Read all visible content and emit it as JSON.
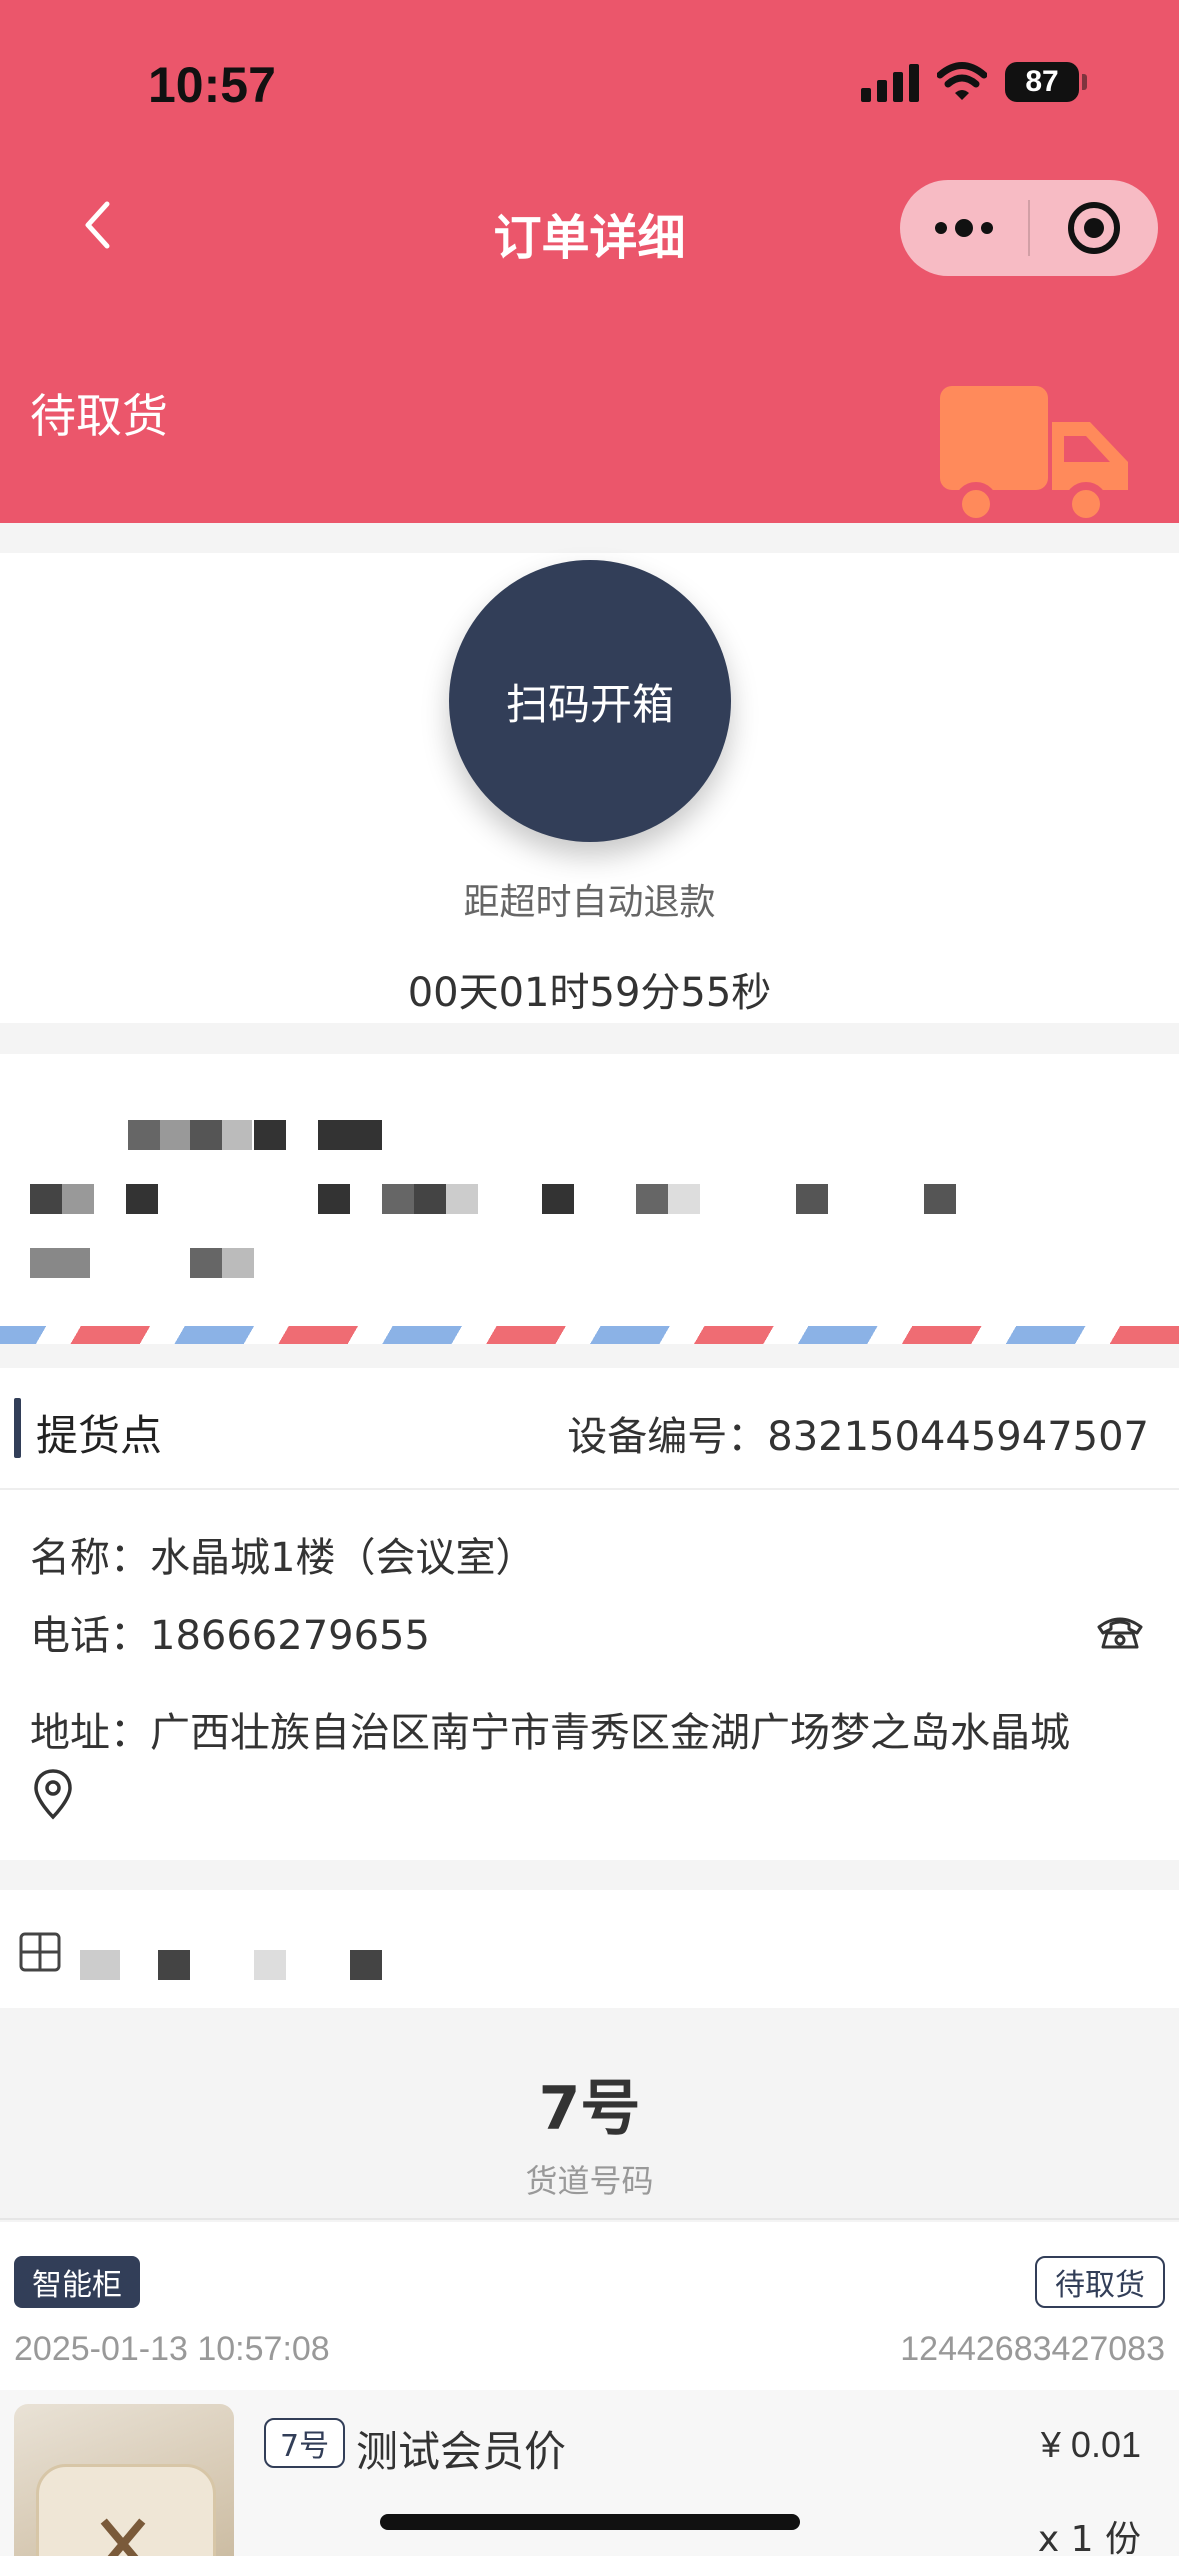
{
  "status_bar": {
    "time": "10:57",
    "battery": "87"
  },
  "nav": {
    "title": "订单详细"
  },
  "header": {
    "status": "待取货"
  },
  "scan": {
    "button_label": "扫码开箱",
    "refund_label": "距超时自动退款",
    "countdown": "00天01时59分55秒"
  },
  "pickup": {
    "title": "提货点",
    "device_label": "设备编号：",
    "device_no": "832150445947507",
    "name": "名称：水晶城1楼（会议室）",
    "phone": "电话：18666279655",
    "address": "地址：广西壮族自治区南宁市青秀区金湖广场梦之岛水晶城"
  },
  "slot": {
    "number": "7号",
    "label": "货道号码"
  },
  "order": {
    "type_tag": "智能柜",
    "status_tag": "待取货",
    "time": "2025-01-13 10:57:08",
    "number": "12442683427083",
    "item": {
      "slot_tag": "7号",
      "name": "测试会员价",
      "price": "¥ 0.01",
      "qty": "x 1 份"
    }
  },
  "colors": {
    "header_bg": "#EB566B",
    "accent": "#323E58",
    "truck": "#FF8A5B"
  }
}
